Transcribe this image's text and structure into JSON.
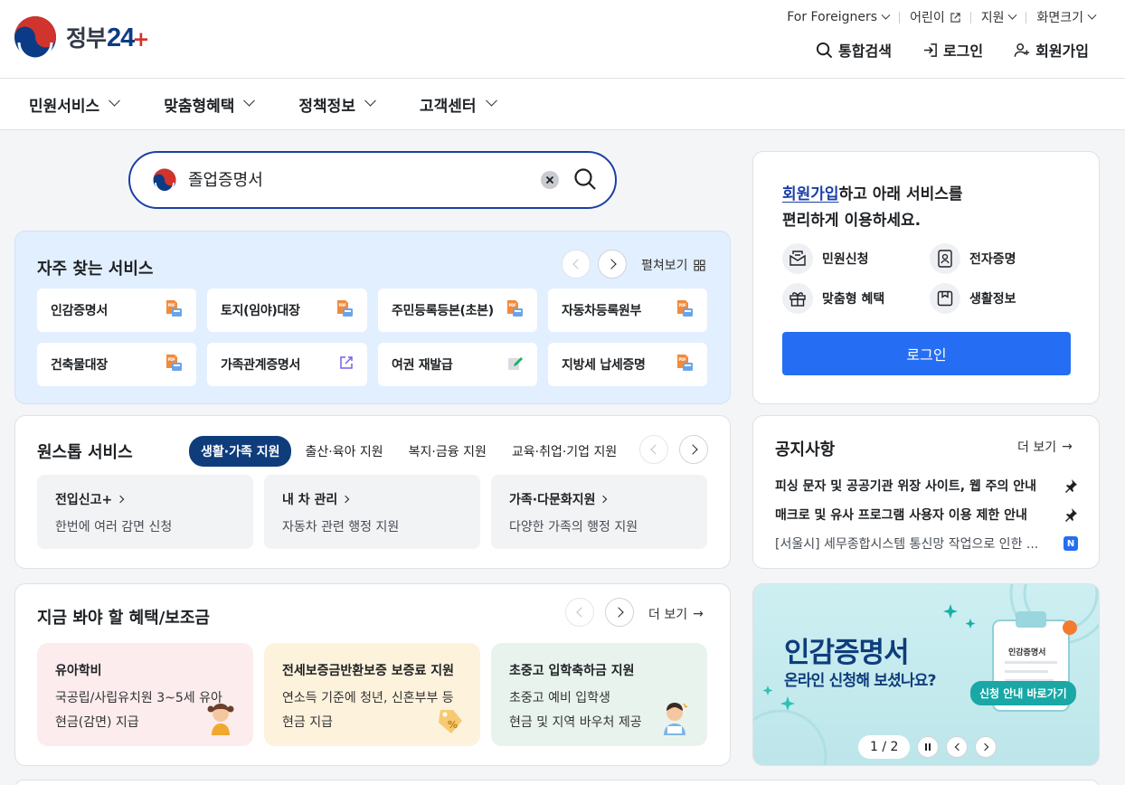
{
  "header": {
    "logo_text": "정부",
    "logo_num": "24",
    "logo_plus": "+",
    "util": [
      "For Foreigners",
      "어린이",
      "지원",
      "화면크기"
    ],
    "actions": {
      "search": "통합검색",
      "login": "로그인",
      "signup": "회원가입"
    }
  },
  "nav": [
    "민원서비스",
    "맞춤형혜택",
    "정책정보",
    "고객센터"
  ],
  "search": {
    "value": "졸업증명서"
  },
  "frequent": {
    "title": "자주 찾는 서비스",
    "expand": "펼쳐보기",
    "items": [
      {
        "label": "인감증명서",
        "icon": "document-print-icon"
      },
      {
        "label": "토지(임야)대장",
        "icon": "document-print-icon"
      },
      {
        "label": "주민등록등본(초본)",
        "icon": "document-print-icon"
      },
      {
        "label": "자동차등록원부",
        "icon": "document-print-icon"
      },
      {
        "label": "건축물대장",
        "icon": "document-print-icon"
      },
      {
        "label": "가족관계증명서",
        "icon": "external-link-icon"
      },
      {
        "label": "여권 재발급",
        "icon": "edit-icon"
      },
      {
        "label": "지방세 납세증명",
        "icon": "document-print-icon"
      }
    ]
  },
  "onestop": {
    "title": "원스톱 서비스",
    "tabs": [
      "생활·가족 지원",
      "출산·육아 지원",
      "복지·금융 지원",
      "교육·취업·기업 지원"
    ],
    "cards": [
      {
        "title": "전입신고+",
        "desc": "한번에 여러 감면 신청"
      },
      {
        "title": "내 차 관리",
        "desc": "자동차 관련 행정 지원"
      },
      {
        "title": "가족·다문화지원",
        "desc": "다양한 가족의 행정 지원"
      }
    ]
  },
  "benefits": {
    "title": "지금 봐야 할 혜택/보조금",
    "more": "더 보기",
    "cards": [
      {
        "title": "유아학비",
        "line1": "국공립/사립유치원 3~5세 유아",
        "line2": "현금(감면) 지급",
        "bg": "#fcecee"
      },
      {
        "title": "전세보증금반환보증 보증료 지원",
        "line1": "연소득 기준에 청년, 신혼부부 등",
        "line2": "현금 지급",
        "bg": "#fdf2dc"
      },
      {
        "title": "초중고 입학축하금 지원",
        "line1": "초중고 예비 입학생",
        "line2": "현금 및 지역 바우처 제공",
        "bg": "#e9f3ee"
      }
    ]
  },
  "login_panel": {
    "highlight": "회원가입",
    "msg1": "하고 아래 서비스를",
    "msg2": "편리하게 이용하세요.",
    "quick": [
      {
        "label": "민원신청",
        "icon": "mail-icon"
      },
      {
        "label": "전자증명",
        "icon": "id-card-icon"
      },
      {
        "label": "맞춤형 혜택",
        "icon": "gift-icon"
      },
      {
        "label": "생활정보",
        "icon": "bookmark-icon"
      }
    ],
    "button": "로그인"
  },
  "notice": {
    "title": "공지사항",
    "more": "더 보기",
    "items": [
      {
        "text": "피싱 문자 및 공공기관 위장 사이트, 웹 주의 안내",
        "badge": "pin"
      },
      {
        "text": "매크로 및 유사 프로그램 사용자 이용 제한 안내",
        "badge": "pin"
      },
      {
        "text": "[서울시] 세무종합시스템 통신망 작업으로 인한 ...",
        "badge": "N"
      }
    ]
  },
  "banner": {
    "title": "인감증명서",
    "subtitle": "온라인 신청해 보셨나요?",
    "cta": "신청 안내 바로가기",
    "card_label": "인감증명서",
    "pager": "1 / 2"
  },
  "colors": {
    "primary": "#256ef4",
    "navy": "#0f3d7c",
    "search_border": "#1b3fa6"
  }
}
